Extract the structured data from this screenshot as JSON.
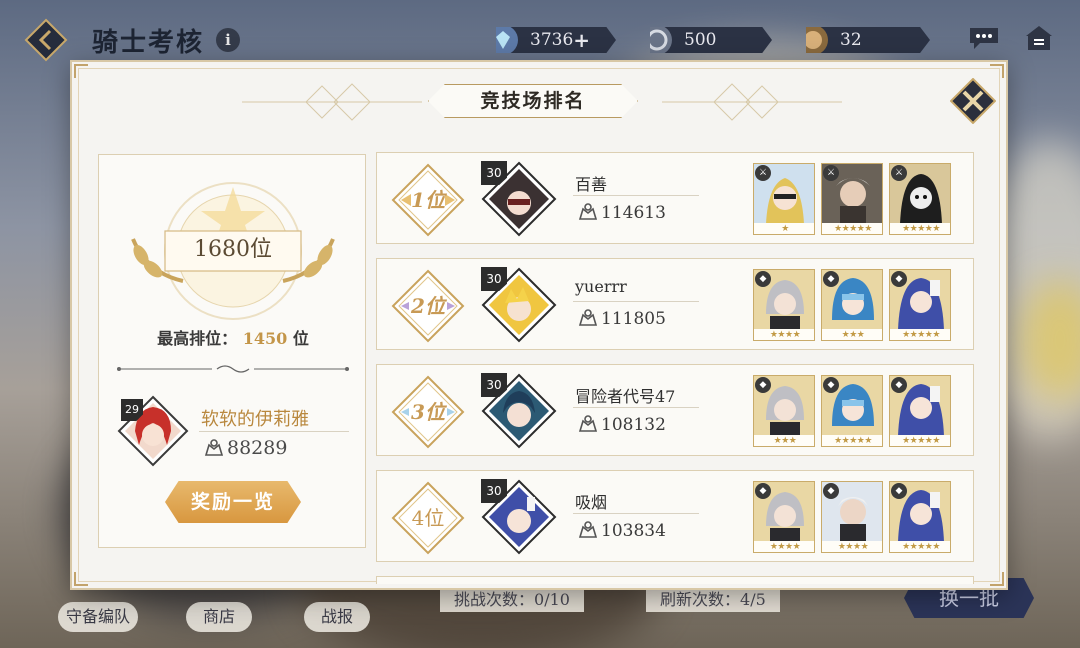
{
  "header": {
    "title": "骑士考核",
    "info_icon": "i",
    "currencies": [
      {
        "icon": "gem-icon",
        "value": "3736",
        "has_plus": true,
        "plus": "+"
      },
      {
        "icon": "coin-icon",
        "value": "500",
        "has_plus": false
      },
      {
        "icon": "ticket-icon",
        "value": "32",
        "has_plus": false
      }
    ]
  },
  "modal": {
    "title": "竞技场排名"
  },
  "my_rank": {
    "rank": "1680位",
    "best_label": "最高排位：",
    "best_value": "1450",
    "best_suffix": "位",
    "level": "29",
    "name": "软软的伊莉雅",
    "power": "88289",
    "reward_button": "奖励一览"
  },
  "rankings": [
    {
      "rank": "1位",
      "level": "30",
      "name": "百善",
      "power": "114613",
      "team": [
        {
          "stars": "★",
          "color": "#4a6ab0"
        },
        {
          "stars": "★★★★★",
          "color": "#8a7a6a"
        },
        {
          "stars": "★★★★★",
          "color": "#222222"
        }
      ]
    },
    {
      "rank": "2位",
      "level": "30",
      "name": "yuerrr",
      "power": "111805",
      "team": [
        {
          "stars": "★★★★",
          "color": "#9a9aa0"
        },
        {
          "stars": "★★★",
          "color": "#3a7ab8"
        },
        {
          "stars": "★★★★★",
          "color": "#4a5cae"
        }
      ]
    },
    {
      "rank": "3位",
      "level": "30",
      "name": "冒险者代号47",
      "power": "108132",
      "team": [
        {
          "stars": "★★★",
          "color": "#9a9aa0"
        },
        {
          "stars": "★★★★★",
          "color": "#3a7ab8"
        },
        {
          "stars": "★★★★★",
          "color": "#4a5cae"
        }
      ]
    },
    {
      "rank": "4位",
      "level": "30",
      "name": "吸烟",
      "power": "103834",
      "team": [
        {
          "stars": "★★★★",
          "color": "#9a9aa0"
        },
        {
          "stars": "★★★★",
          "color": "#b8bcc4"
        },
        {
          "stars": "★★★★★",
          "color": "#4a5cae"
        }
      ]
    }
  ],
  "bottom": {
    "defense_team": "守备编队",
    "shop": "商店",
    "battle_report": "战报",
    "challenge_label": "挑战次数：",
    "challenge_value": "0/10",
    "refresh_label": "刷新次数：",
    "refresh_value": "4/5",
    "switch_button": "换一批"
  },
  "colors": {
    "accent_gold": "#c89a55",
    "panel_bg": "#f5f4f1",
    "reward_button": "#dda04a"
  }
}
